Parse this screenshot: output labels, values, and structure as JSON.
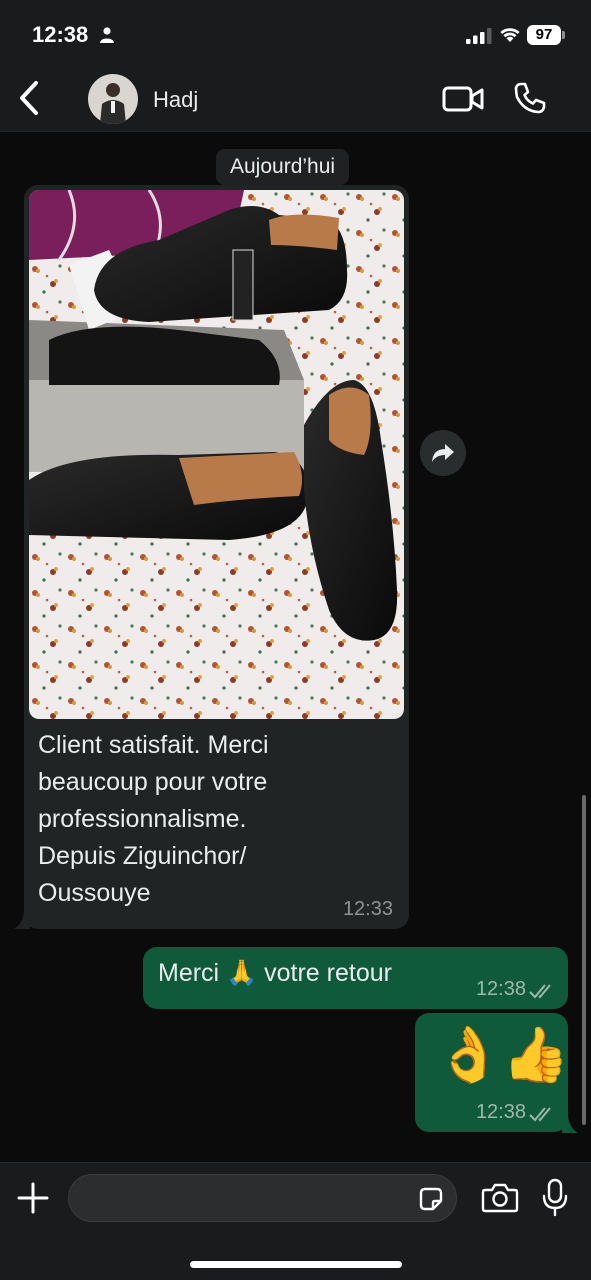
{
  "status_bar": {
    "time": "12:38",
    "battery": "97",
    "icons": [
      "person-icon",
      "signal-icon",
      "wifi-icon",
      "battery-icon"
    ]
  },
  "header": {
    "contact_name": "Hadj",
    "icons": [
      "back-chevron-icon",
      "avatar",
      "video-call-icon",
      "phone-icon"
    ]
  },
  "chat": {
    "date_label": "Aujourd’hui",
    "incoming": {
      "image_description_icon": "photo-of-shoes",
      "text": "Client satisfait. Merci\nbeaucoup pour votre\nprofessionnalisme.\nDepuis Ziguinchor/\nOussouye",
      "time": "12:33"
    },
    "outgoing": [
      {
        "text": "Merci 🙏 votre retour",
        "time": "12:38",
        "status": "read-ticks"
      },
      {
        "text": "👌👍",
        "time": "12:38",
        "status": "read-ticks"
      }
    ]
  },
  "composer": {
    "placeholder": "",
    "icons": [
      "plus-icon",
      "sticker-icon",
      "camera-icon",
      "microphone-icon"
    ]
  },
  "colors": {
    "background": "#0b0b0b",
    "bar": "#1a1b1c",
    "incoming_bubble": "#212424",
    "outgoing_bubble": "#0f5a3a",
    "accent": "#8ea7b4"
  }
}
